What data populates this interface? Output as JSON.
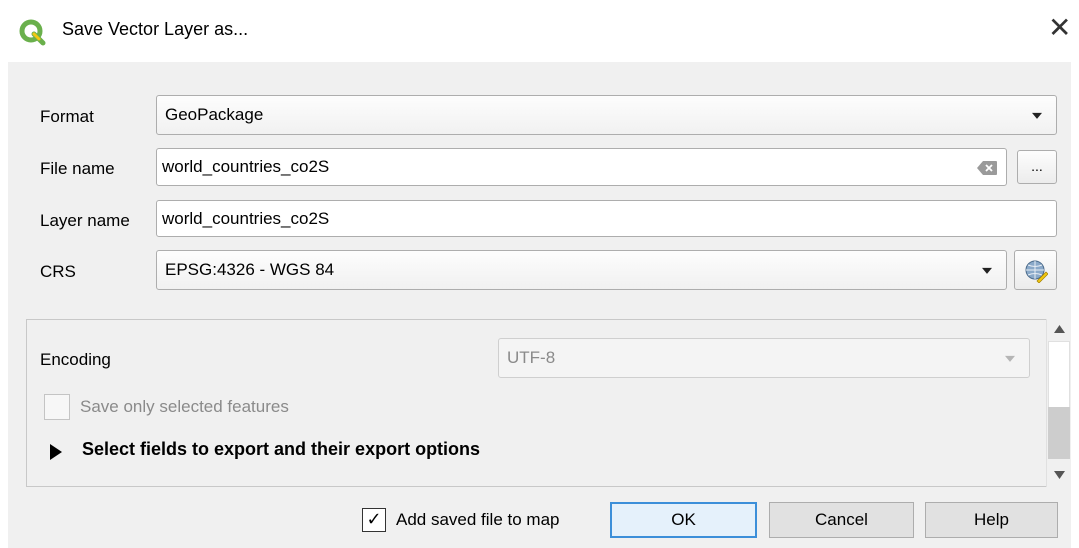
{
  "window": {
    "title": "Save Vector Layer as...",
    "close_glyph": "✕"
  },
  "format": {
    "label": "Format",
    "value": "GeoPackage"
  },
  "file_name": {
    "label": "File name",
    "value": "world_countries_co2S",
    "browse_label": "..."
  },
  "layer_name": {
    "label": "Layer name",
    "value": "world_countries_co2S"
  },
  "crs": {
    "label": "CRS",
    "value": "EPSG:4326 - WGS 84"
  },
  "options": {
    "encoding_label": "Encoding",
    "encoding_value": "UTF-8",
    "selected_only_label": "Save only selected features",
    "selected_only_checked": false,
    "fields_section_label": "Select fields to export and their export options"
  },
  "footer": {
    "add_to_map_label": "Add saved file to map",
    "add_to_map_checked": true,
    "ok_label": "OK",
    "cancel_label": "Cancel",
    "help_label": "Help"
  },
  "icons": {
    "app": "qgis-logo-icon",
    "clear": "backspace-clear-icon",
    "crs": "globe-pencil-icon"
  },
  "colors": {
    "accent": "#3c8fd9",
    "qgis_green": "#6ab04c",
    "qgis_yellow": "#f2c811"
  }
}
